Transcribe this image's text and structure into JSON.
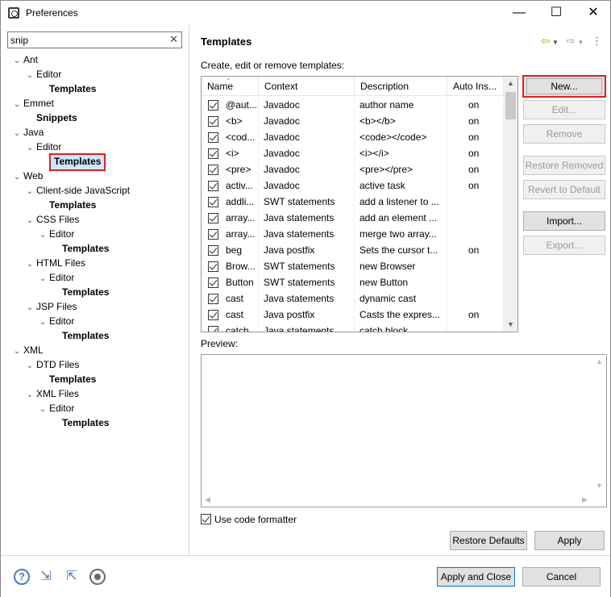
{
  "window": {
    "title": "Preferences",
    "minimize": "—",
    "maximize": "☐",
    "close": "✕"
  },
  "filter": {
    "value": "snip",
    "clear_glyph": "✕"
  },
  "tree": [
    {
      "label": "Ant",
      "level": 0,
      "expanded": true,
      "bold": false
    },
    {
      "label": "Editor",
      "level": 1,
      "expanded": true,
      "bold": false
    },
    {
      "label": "Templates",
      "level": 2,
      "bold": true
    },
    {
      "label": "Emmet",
      "level": 0,
      "expanded": true,
      "bold": false
    },
    {
      "label": "Snippets",
      "level": 1,
      "bold": true
    },
    {
      "label": "Java",
      "level": 0,
      "expanded": true,
      "bold": false
    },
    {
      "label": "Editor",
      "level": 1,
      "expanded": true,
      "bold": false
    },
    {
      "label": "Templates",
      "level": 2,
      "bold": true,
      "selected": true
    },
    {
      "label": "Web",
      "level": 0,
      "expanded": true,
      "bold": false
    },
    {
      "label": "Client-side JavaScript",
      "level": 1,
      "expanded": true,
      "bold": false
    },
    {
      "label": "Templates",
      "level": 2,
      "bold": true
    },
    {
      "label": "CSS Files",
      "level": 1,
      "expanded": true,
      "bold": false
    },
    {
      "label": "Editor",
      "level": 2,
      "expanded": true,
      "bold": false
    },
    {
      "label": "Templates",
      "level": 3,
      "bold": true
    },
    {
      "label": "HTML Files",
      "level": 1,
      "expanded": true,
      "bold": false
    },
    {
      "label": "Editor",
      "level": 2,
      "expanded": true,
      "bold": false
    },
    {
      "label": "Templates",
      "level": 3,
      "bold": true
    },
    {
      "label": "JSP Files",
      "level": 1,
      "expanded": true,
      "bold": false
    },
    {
      "label": "Editor",
      "level": 2,
      "expanded": true,
      "bold": false
    },
    {
      "label": "Templates",
      "level": 3,
      "bold": true
    },
    {
      "label": "XML",
      "level": 0,
      "expanded": true,
      "bold": false
    },
    {
      "label": "DTD Files",
      "level": 1,
      "expanded": true,
      "bold": false
    },
    {
      "label": "Templates",
      "level": 2,
      "bold": true
    },
    {
      "label": "XML Files",
      "level": 1,
      "expanded": true,
      "bold": false
    },
    {
      "label": "Editor",
      "level": 2,
      "expanded": true,
      "bold": false
    },
    {
      "label": "Templates",
      "level": 3,
      "bold": true
    }
  ],
  "page": {
    "title": "Templates",
    "create_label": "Create, edit or remove templates:",
    "preview_label": "Preview:",
    "use_formatter_label": "Use code formatter"
  },
  "table": {
    "columns": [
      "Name",
      "Context",
      "Description",
      "Auto Ins..."
    ],
    "rows": [
      {
        "name": "@aut...",
        "context": "Javadoc",
        "description": "author name",
        "auto": "on"
      },
      {
        "name": "<b>",
        "context": "Javadoc",
        "description": "<b></b>",
        "auto": "on"
      },
      {
        "name": "<cod...",
        "context": "Javadoc",
        "description": "<code></code>",
        "auto": "on"
      },
      {
        "name": "<i>",
        "context": "Javadoc",
        "description": "<i></i>",
        "auto": "on"
      },
      {
        "name": "<pre>",
        "context": "Javadoc",
        "description": "<pre></pre>",
        "auto": "on"
      },
      {
        "name": "activ...",
        "context": "Javadoc",
        "description": "active task",
        "auto": "on"
      },
      {
        "name": "addli...",
        "context": "SWT statements",
        "description": "add a listener to ...",
        "auto": ""
      },
      {
        "name": "array...",
        "context": "Java statements",
        "description": "add an element ...",
        "auto": ""
      },
      {
        "name": "array...",
        "context": "Java statements",
        "description": "merge two array...",
        "auto": ""
      },
      {
        "name": "beg",
        "context": "Java postfix",
        "description": "Sets the cursor t...",
        "auto": "on"
      },
      {
        "name": "Brow...",
        "context": "SWT statements",
        "description": "new Browser",
        "auto": ""
      },
      {
        "name": "Button",
        "context": "SWT statements",
        "description": "new Button",
        "auto": ""
      },
      {
        "name": "cast",
        "context": "Java statements",
        "description": "dynamic cast",
        "auto": ""
      },
      {
        "name": "cast",
        "context": "Java postfix",
        "description": "Casts the expres...",
        "auto": "on"
      },
      {
        "name": "catch",
        "context": "Java statements",
        "description": "catch block",
        "auto": ""
      }
    ]
  },
  "side_buttons": {
    "new": "New...",
    "edit": "Edit...",
    "remove": "Remove",
    "restore_removed": "Restore Removed",
    "revert_default": "Revert to Default",
    "import": "Import...",
    "export": "Export..."
  },
  "page_buttons": {
    "restore_defaults": "Restore Defaults",
    "apply": "Apply"
  },
  "dialog_buttons": {
    "apply_close": "Apply and Close",
    "cancel": "Cancel"
  },
  "icons": {
    "help": "?",
    "back": "⇦",
    "forward": "⇨",
    "menu": "⋮",
    "import_prefs": "⇲",
    "export_prefs": "⇱"
  },
  "colors": {
    "selection": "#cce8ff",
    "highlight_border": "#e02020",
    "primary_border": "#0078d7"
  }
}
